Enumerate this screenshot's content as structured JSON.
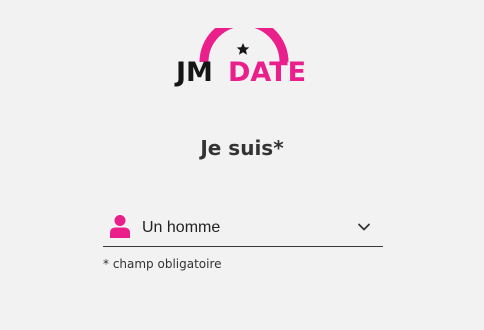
{
  "brand": {
    "logo_left": "JM",
    "logo_right": "DATE",
    "accent_color": "#ea1f8b",
    "dark_color": "#151515"
  },
  "form": {
    "heading": "Je suis*",
    "gender_select": {
      "icon": "person-icon",
      "selected_value": "Un homme",
      "dropdown_icon": "chevron-down-icon"
    },
    "required_note": "* champ obligatoire"
  }
}
